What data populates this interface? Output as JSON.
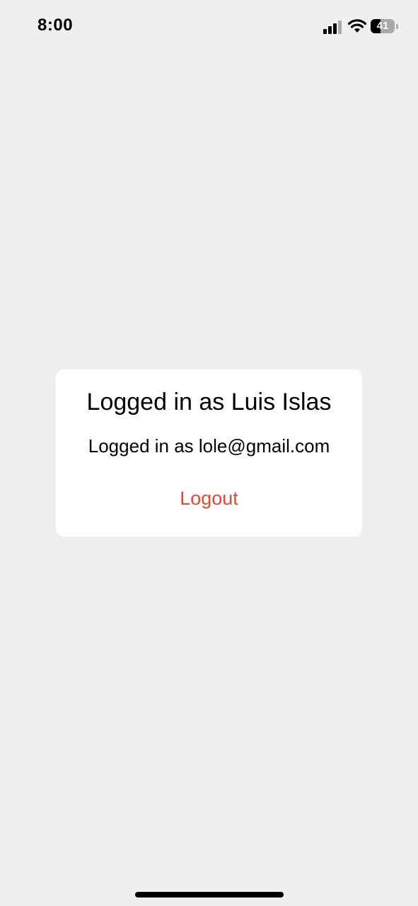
{
  "status_bar": {
    "time": "8:00",
    "battery_level": "41",
    "battery_fraction": 0.41,
    "icons": [
      "signal-icon",
      "wifi-icon",
      "battery-icon"
    ]
  },
  "card": {
    "title": "Logged in as Luis Islas",
    "subtitle": "Logged in as lole@gmail.com",
    "logout_label": "Logout"
  },
  "colors": {
    "background": "#efefef",
    "card": "#ffffff",
    "logout": "#e04a32"
  }
}
